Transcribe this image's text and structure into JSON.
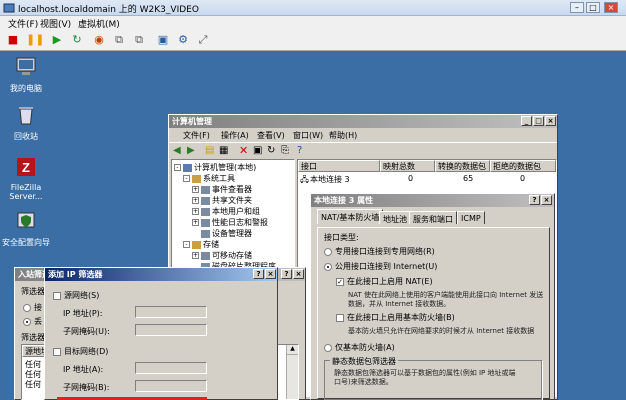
{
  "vm": {
    "title": "localhost.localdomain 上的 W2K3_VIDEO",
    "menu": [
      "文件(F)",
      "视图(V)",
      "虚拟机(M)"
    ]
  },
  "desktop": {
    "icons": [
      {
        "label": "我的电脑",
        "icon": "computer-icon"
      },
      {
        "label": "回收站",
        "icon": "recycle-bin-icon"
      },
      {
        "label": "FileZilla Server...",
        "icon": "filezilla-icon"
      },
      {
        "label": "安全配置向导",
        "icon": "security-wizard-icon"
      }
    ]
  },
  "compmgmt": {
    "title": "计算机管理",
    "menu": [
      "文件(F)",
      "操作(A)",
      "查看(V)",
      "窗口(W)",
      "帮助(H)"
    ],
    "tree": [
      {
        "label": "计算机管理(本地)",
        "level": 0,
        "exp": "-"
      },
      {
        "label": "系统工具",
        "level": 1,
        "exp": "-"
      },
      {
        "label": "事件查看器",
        "level": 2,
        "exp": "+"
      },
      {
        "label": "共享文件夹",
        "level": 2,
        "exp": "+"
      },
      {
        "label": "本地用户和组",
        "level": 2,
        "exp": "+"
      },
      {
        "label": "性能日志和警报",
        "level": 2,
        "exp": "+"
      },
      {
        "label": "设备管理器",
        "level": 2,
        "exp": ""
      },
      {
        "label": "存储",
        "level": 1,
        "exp": "-"
      },
      {
        "label": "可移动存储",
        "level": 2,
        "exp": "+"
      },
      {
        "label": "磁盘碎片整理程序",
        "level": 2,
        "exp": ""
      },
      {
        "label": "磁盘管理",
        "level": 2,
        "exp": ""
      }
    ],
    "columns": [
      "接口",
      "映射总数",
      "转换的数据包",
      "拒绝的数据包"
    ],
    "row": [
      "本地连接 3",
      "0",
      "65",
      "0"
    ]
  },
  "props": {
    "title": "本地连接 3 属性",
    "tabs": [
      "NAT/基本防火墙",
      "地址池",
      "服务和端口",
      "ICMP"
    ],
    "iface_type": "接口类型:",
    "opt_private": "专用接口连接到专用网络(R)",
    "opt_public": "公用接口连接到 Internet(U)",
    "nat_chk": "在此接口上启用 NAT(E)",
    "nat_desc1": "NAT 使在此网络上使用的客户端能使用此接口向 Internet 发送",
    "nat_desc2": "数据，并从 Internet 接收数据。",
    "fw_chk": "在此接口上启用基本防火墙(B)",
    "fw_desc": "基本防火墙只允许在网络要求的时候才从 Internet 接收数据",
    "opt_basic": "仅基本防火墙(A)",
    "group_title": "静态数据包筛选器",
    "group_desc1": "静态数据包筛选器可以基于数据包的属性(例如 IP 地址或端",
    "group_desc2": "口号)来筛选数据。"
  },
  "inbound": {
    "title": "入站筛选器",
    "lbl1": "筛选器",
    "opt1": "接",
    "opt2": "丢",
    "lbl2": "筛选器",
    "col": "源地址",
    "rows": [
      "任何",
      "任何",
      "任何"
    ]
  },
  "addip": {
    "title": "添加 IP 筛选器",
    "src_net": "源网络(S)",
    "ip_addr": "IP 地址(P):",
    "subnet": "子网掩码(U):",
    "dst_net": "目标网络(D)",
    "ip_addr2": "IP 地址(A):",
    "subnet2": "子网掩码(B):"
  }
}
